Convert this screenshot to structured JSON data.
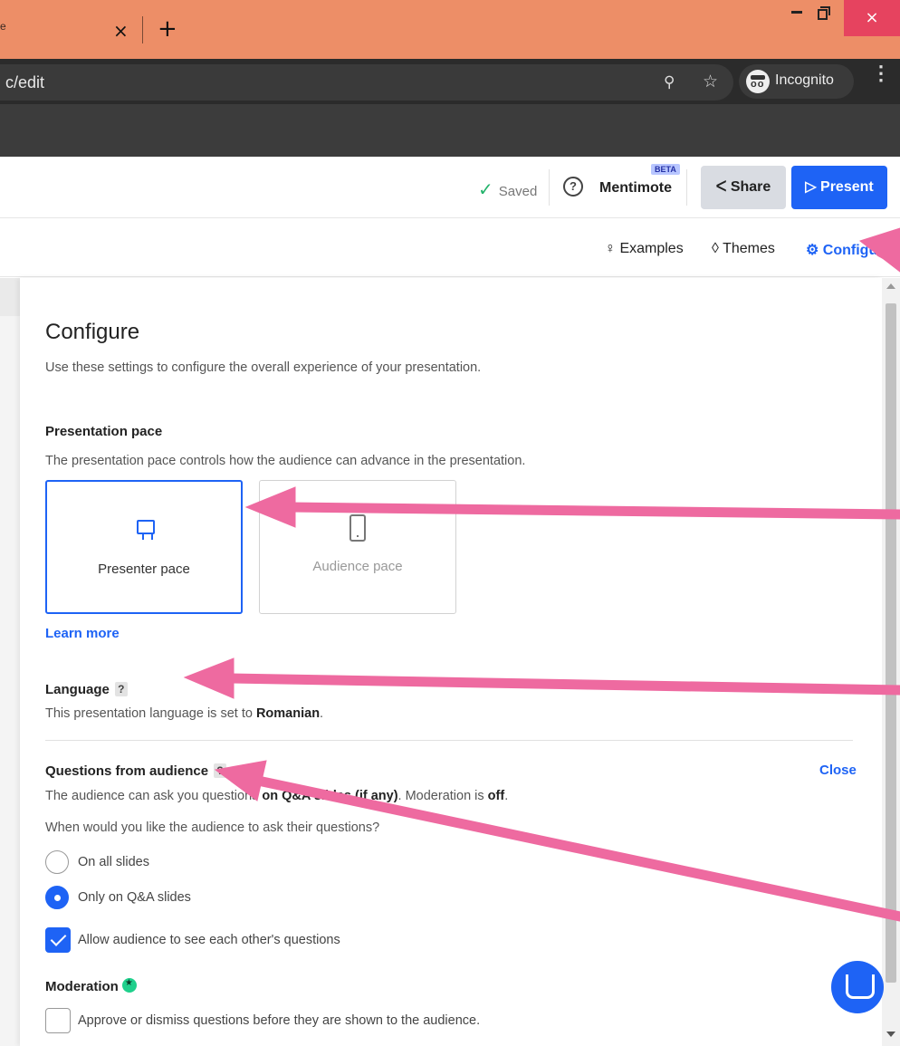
{
  "browser": {
    "tab_edge_char": "e",
    "tab_close": "×",
    "new_tab": "+",
    "window_close": "×",
    "url": "c/edit",
    "zoom_icon_glyph": "⚲",
    "star_icon_glyph": "☆",
    "profile_label": "Incognito",
    "menu_glyph": "⋮"
  },
  "topbar": {
    "saved_check": "✓",
    "saved_label": "Saved",
    "help_glyph": "?",
    "mentimote_label": "Mentimote",
    "beta_badge": "BETA",
    "share_label": "ᐸ Share",
    "present_label": "▷ Present"
  },
  "subbar": {
    "examples_label": "♀ Examples",
    "themes_label": "◊ Themes",
    "configure_label": "⚙ Configure"
  },
  "configure": {
    "title": "Configure",
    "subtitle": "Use these settings to configure the overall experience of your presentation.",
    "pace": {
      "heading": "Presentation pace",
      "description": "The presentation pace controls how the audience can advance in the presentation.",
      "presenter_label": "Presenter pace",
      "audience_label": "Audience pace",
      "selected": "Presenter pace",
      "learn_more": "Learn more"
    },
    "language": {
      "heading": "Language",
      "help": "?",
      "description_prefix": "This presentation language is set to ",
      "language_value": "Romanian",
      "description_suffix": "."
    },
    "questions": {
      "heading": "Questions from audience",
      "help": "?",
      "close_label": "Close",
      "description_prefix": "The audience can ask you questions ",
      "description_bold": "on Q&A slides (if any)",
      "description_mid": ". Moderation is ",
      "moderation_state": "off",
      "description_suffix": ".",
      "prompt": "When would you like the audience to ask their questions?",
      "options": [
        {
          "label": "On all slides",
          "selected": false
        },
        {
          "label": "Only on Q&A slides",
          "selected": true
        }
      ],
      "see_others_label": "Allow audience to see each other's questions",
      "see_others_checked": true
    },
    "moderation": {
      "heading": "Moderation",
      "approve_label": "Approve or dismiss questions before they are shown to the audience.",
      "approve_checked": false
    }
  },
  "colors": {
    "accent": "#1e63f5",
    "tab_bar": "#ed8e67",
    "annotation_arrow": "#ee6aa0",
    "saved_green": "#23b36b"
  }
}
